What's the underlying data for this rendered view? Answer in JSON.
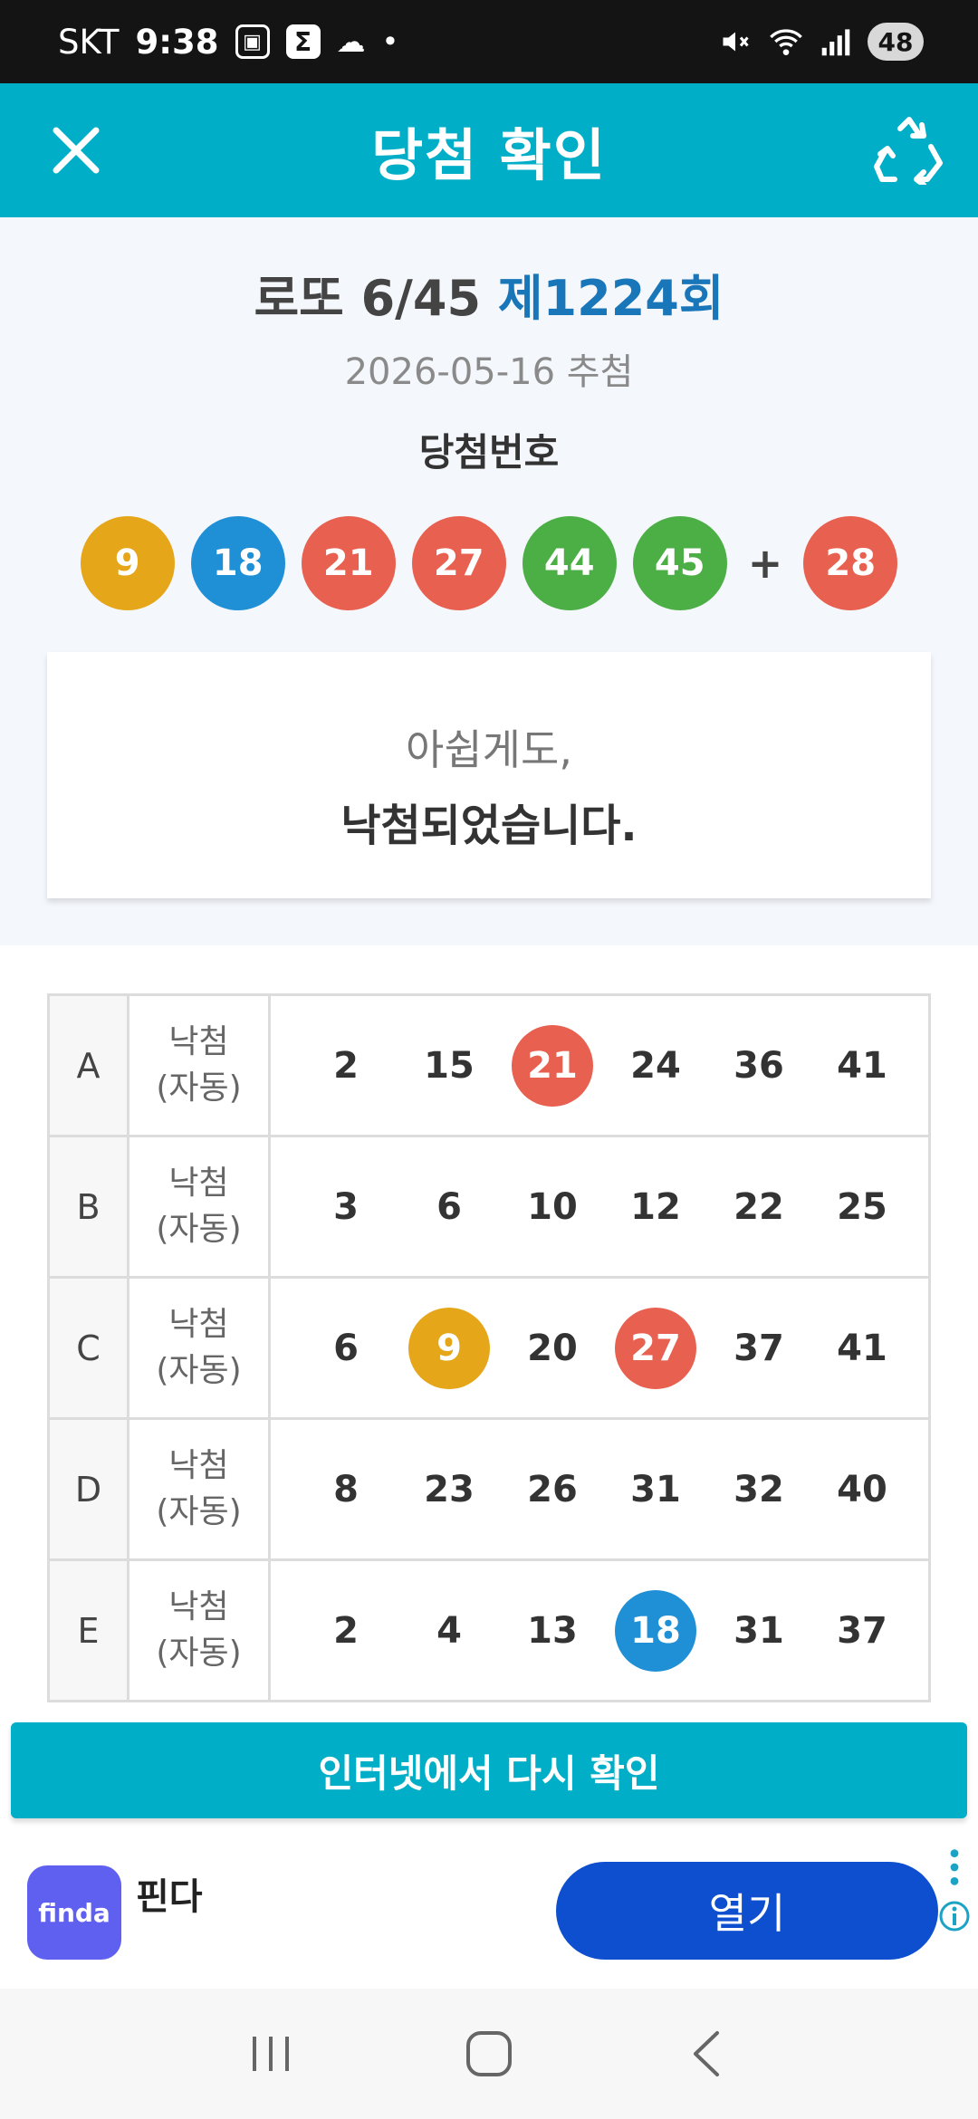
{
  "status_bar": {
    "carrier": "SKT",
    "time": "9:38",
    "battery": "48"
  },
  "header": {
    "title": "당첨 확인",
    "close_icon": "close-icon",
    "recycle_icon": "recycle-icon"
  },
  "draw": {
    "title_prefix": "로또 6/45",
    "round": "제1224회",
    "date": "2026-05-16 추첨",
    "winning_label": "당첨번호",
    "plus": "+",
    "numbers": [
      {
        "value": "9",
        "color": "#e5a719"
      },
      {
        "value": "18",
        "color": "#1f8fd6"
      },
      {
        "value": "21",
        "color": "#e8604f"
      },
      {
        "value": "27",
        "color": "#e8604f"
      },
      {
        "value": "44",
        "color": "#4caf45"
      },
      {
        "value": "45",
        "color": "#4caf45"
      }
    ],
    "bonus": {
      "value": "28",
      "color": "#e8604f"
    }
  },
  "result": {
    "line1": "아쉽게도,",
    "line2": "낙첨되었습니다."
  },
  "tickets": [
    {
      "letter": "A",
      "status1": "낙첨",
      "status2": "(자동)",
      "numbers": [
        "2",
        "15",
        "21",
        "24",
        "36",
        "41"
      ],
      "hits": {
        "21": "#e8604f"
      }
    },
    {
      "letter": "B",
      "status1": "낙첨",
      "status2": "(자동)",
      "numbers": [
        "3",
        "6",
        "10",
        "12",
        "22",
        "25"
      ],
      "hits": {}
    },
    {
      "letter": "C",
      "status1": "낙첨",
      "status2": "(자동)",
      "numbers": [
        "6",
        "9",
        "20",
        "27",
        "37",
        "41"
      ],
      "hits": {
        "9": "#e5a719",
        "27": "#e8604f"
      }
    },
    {
      "letter": "D",
      "status1": "낙첨",
      "status2": "(자동)",
      "numbers": [
        "8",
        "23",
        "26",
        "31",
        "32",
        "40"
      ],
      "hits": {}
    },
    {
      "letter": "E",
      "status1": "낙첨",
      "status2": "(자동)",
      "numbers": [
        "2",
        "4",
        "13",
        "18",
        "31",
        "37"
      ],
      "hits": {
        "18": "#1f8fd6"
      }
    }
  ],
  "recheck_button": "인터넷에서 다시 확인",
  "ad": {
    "logo_text": "finda",
    "name": "핀다",
    "open_label": "열기"
  },
  "colors": {
    "accent": "#00aec7",
    "round_blue": "#1976b8",
    "ad_button": "#0e4fd0"
  }
}
